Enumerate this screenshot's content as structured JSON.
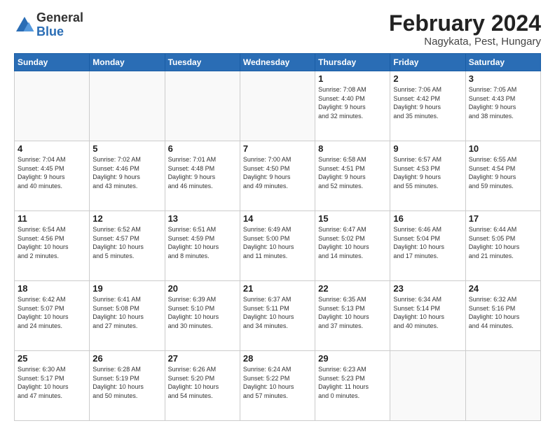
{
  "logo": {
    "general": "General",
    "blue": "Blue"
  },
  "title": "February 2024",
  "subtitle": "Nagykata, Pest, Hungary",
  "headers": [
    "Sunday",
    "Monday",
    "Tuesday",
    "Wednesday",
    "Thursday",
    "Friday",
    "Saturday"
  ],
  "weeks": [
    [
      {
        "day": "",
        "info": ""
      },
      {
        "day": "",
        "info": ""
      },
      {
        "day": "",
        "info": ""
      },
      {
        "day": "",
        "info": ""
      },
      {
        "day": "1",
        "info": "Sunrise: 7:08 AM\nSunset: 4:40 PM\nDaylight: 9 hours\nand 32 minutes."
      },
      {
        "day": "2",
        "info": "Sunrise: 7:06 AM\nSunset: 4:42 PM\nDaylight: 9 hours\nand 35 minutes."
      },
      {
        "day": "3",
        "info": "Sunrise: 7:05 AM\nSunset: 4:43 PM\nDaylight: 9 hours\nand 38 minutes."
      }
    ],
    [
      {
        "day": "4",
        "info": "Sunrise: 7:04 AM\nSunset: 4:45 PM\nDaylight: 9 hours\nand 40 minutes."
      },
      {
        "day": "5",
        "info": "Sunrise: 7:02 AM\nSunset: 4:46 PM\nDaylight: 9 hours\nand 43 minutes."
      },
      {
        "day": "6",
        "info": "Sunrise: 7:01 AM\nSunset: 4:48 PM\nDaylight: 9 hours\nand 46 minutes."
      },
      {
        "day": "7",
        "info": "Sunrise: 7:00 AM\nSunset: 4:50 PM\nDaylight: 9 hours\nand 49 minutes."
      },
      {
        "day": "8",
        "info": "Sunrise: 6:58 AM\nSunset: 4:51 PM\nDaylight: 9 hours\nand 52 minutes."
      },
      {
        "day": "9",
        "info": "Sunrise: 6:57 AM\nSunset: 4:53 PM\nDaylight: 9 hours\nand 55 minutes."
      },
      {
        "day": "10",
        "info": "Sunrise: 6:55 AM\nSunset: 4:54 PM\nDaylight: 9 hours\nand 59 minutes."
      }
    ],
    [
      {
        "day": "11",
        "info": "Sunrise: 6:54 AM\nSunset: 4:56 PM\nDaylight: 10 hours\nand 2 minutes."
      },
      {
        "day": "12",
        "info": "Sunrise: 6:52 AM\nSunset: 4:57 PM\nDaylight: 10 hours\nand 5 minutes."
      },
      {
        "day": "13",
        "info": "Sunrise: 6:51 AM\nSunset: 4:59 PM\nDaylight: 10 hours\nand 8 minutes."
      },
      {
        "day": "14",
        "info": "Sunrise: 6:49 AM\nSunset: 5:00 PM\nDaylight: 10 hours\nand 11 minutes."
      },
      {
        "day": "15",
        "info": "Sunrise: 6:47 AM\nSunset: 5:02 PM\nDaylight: 10 hours\nand 14 minutes."
      },
      {
        "day": "16",
        "info": "Sunrise: 6:46 AM\nSunset: 5:04 PM\nDaylight: 10 hours\nand 17 minutes."
      },
      {
        "day": "17",
        "info": "Sunrise: 6:44 AM\nSunset: 5:05 PM\nDaylight: 10 hours\nand 21 minutes."
      }
    ],
    [
      {
        "day": "18",
        "info": "Sunrise: 6:42 AM\nSunset: 5:07 PM\nDaylight: 10 hours\nand 24 minutes."
      },
      {
        "day": "19",
        "info": "Sunrise: 6:41 AM\nSunset: 5:08 PM\nDaylight: 10 hours\nand 27 minutes."
      },
      {
        "day": "20",
        "info": "Sunrise: 6:39 AM\nSunset: 5:10 PM\nDaylight: 10 hours\nand 30 minutes."
      },
      {
        "day": "21",
        "info": "Sunrise: 6:37 AM\nSunset: 5:11 PM\nDaylight: 10 hours\nand 34 minutes."
      },
      {
        "day": "22",
        "info": "Sunrise: 6:35 AM\nSunset: 5:13 PM\nDaylight: 10 hours\nand 37 minutes."
      },
      {
        "day": "23",
        "info": "Sunrise: 6:34 AM\nSunset: 5:14 PM\nDaylight: 10 hours\nand 40 minutes."
      },
      {
        "day": "24",
        "info": "Sunrise: 6:32 AM\nSunset: 5:16 PM\nDaylight: 10 hours\nand 44 minutes."
      }
    ],
    [
      {
        "day": "25",
        "info": "Sunrise: 6:30 AM\nSunset: 5:17 PM\nDaylight: 10 hours\nand 47 minutes."
      },
      {
        "day": "26",
        "info": "Sunrise: 6:28 AM\nSunset: 5:19 PM\nDaylight: 10 hours\nand 50 minutes."
      },
      {
        "day": "27",
        "info": "Sunrise: 6:26 AM\nSunset: 5:20 PM\nDaylight: 10 hours\nand 54 minutes."
      },
      {
        "day": "28",
        "info": "Sunrise: 6:24 AM\nSunset: 5:22 PM\nDaylight: 10 hours\nand 57 minutes."
      },
      {
        "day": "29",
        "info": "Sunrise: 6:23 AM\nSunset: 5:23 PM\nDaylight: 11 hours\nand 0 minutes."
      },
      {
        "day": "",
        "info": ""
      },
      {
        "day": "",
        "info": ""
      }
    ]
  ]
}
